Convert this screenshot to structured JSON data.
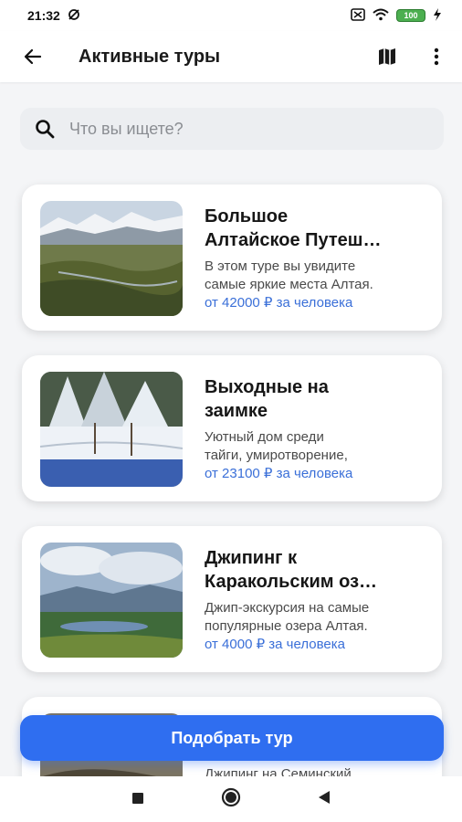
{
  "status": {
    "time": "21:32",
    "battery": "100"
  },
  "header": {
    "title": "Активные туры"
  },
  "search": {
    "placeholder": "Что вы ищете?"
  },
  "tours": [
    {
      "title_line1": "Большое",
      "title_line2": "Алтайское Путеш…",
      "desc_line1": "В этом туре вы увидите",
      "desc_line2": "самые яркие места Алтая.",
      "price": "от 42000 ₽ за человека"
    },
    {
      "title_line1": "Выходные на",
      "title_line2": "заимке",
      "desc_line1": "Уютный дом среди",
      "desc_line2": "тайги, умиротворение,",
      "price": "от 23100 ₽ за человека"
    },
    {
      "title_line1": "Джипинг к",
      "title_line2": "Каракольским оз…",
      "desc_line1": "Джип-экскурсия на самые",
      "desc_line2": "популярные озера Алтая.",
      "price": "от 4000 ₽ за человека"
    },
    {
      "desc_line1": "Джипинг на Семинский"
    }
  ],
  "cta": {
    "label": "Подобрать тур"
  },
  "colors": {
    "accent": "#2f6ef0",
    "price": "#3a6fd8"
  },
  "icons": [
    "wifi-icon",
    "battery-icon",
    "back-arrow-icon",
    "map-icon",
    "more-vert-icon",
    "search-icon",
    "nav-recents-icon",
    "nav-home-icon",
    "nav-back-icon"
  ]
}
